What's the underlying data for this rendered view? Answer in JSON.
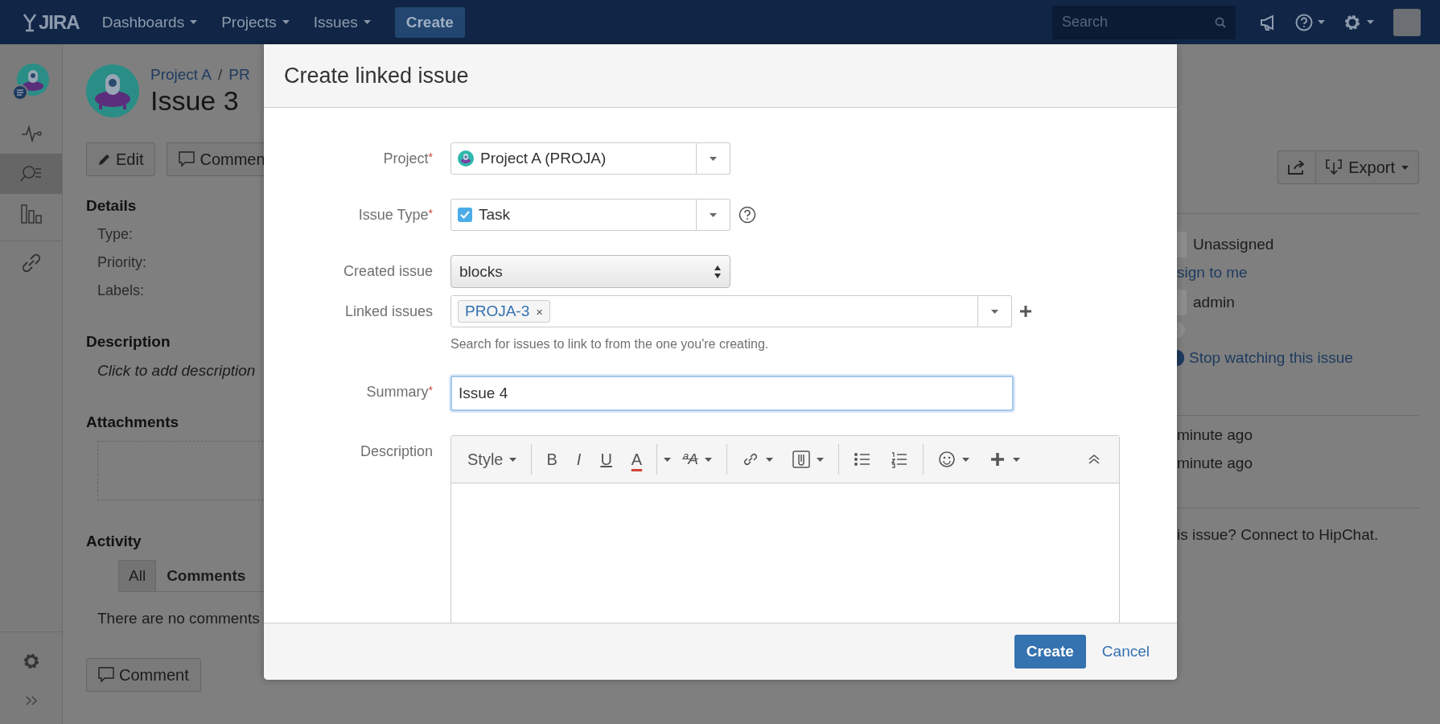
{
  "header": {
    "logo": "JIRA",
    "nav": [
      {
        "label": "Dashboards"
      },
      {
        "label": "Projects"
      },
      {
        "label": "Issues"
      }
    ],
    "create_button": "Create",
    "search": {
      "placeholder": "Search"
    }
  },
  "sidebar": {
    "items": [
      {
        "selected": false
      },
      {
        "selected": true
      },
      {
        "selected": false
      }
    ]
  },
  "issue": {
    "breadcrumb": [
      "Project A",
      "PR"
    ],
    "separator": "/",
    "title": "Issue 3",
    "actions": [
      "Edit",
      "Commen"
    ],
    "details": {
      "heading": "Details",
      "fields": [
        "Type:",
        "Priority:",
        "Labels:"
      ]
    },
    "description": {
      "heading": "Description",
      "placeholder": "Click to add description"
    },
    "attachments": {
      "heading": "Attachments"
    },
    "activity": {
      "heading": "Activity",
      "tabs": [
        {
          "label": "All",
          "selected": false
        },
        {
          "label": "Comments",
          "selected": true
        }
      ],
      "empty": "There are no comments",
      "comment_button": "Comment"
    }
  },
  "side": {
    "export_button": "Export",
    "assignee": "Unassigned",
    "assign_link": "sign to me",
    "reporter": "admin",
    "watch_link": "Stop watching this issue",
    "dates": [
      "minute ago",
      "minute ago"
    ],
    "hipchat": "is issue? Connect to HipChat."
  },
  "dialog": {
    "title": "Create linked issue",
    "fields": [
      {
        "kind": "project",
        "label": "Project",
        "required_mark": "*",
        "value": "Project A (PROJA)"
      },
      {
        "kind": "issue_type",
        "label": "Issue Type",
        "required_mark": "*",
        "value": "Task",
        "help": true
      },
      {
        "kind": "native_select",
        "label": "Created issue",
        "value": "blocks"
      },
      {
        "kind": "tags",
        "label": "Linked issues",
        "tags": [
          {
            "label": "PROJA-3",
            "remove": "×"
          }
        ],
        "hint": "Search for issues to link to from the one you're creating."
      },
      {
        "kind": "text",
        "label": "Summary",
        "required_mark": "*",
        "value": "Issue 4",
        "focused": true
      },
      {
        "kind": "editor",
        "label": "Description",
        "toolbar": {
          "style": "Style",
          "bold": "B",
          "italic": "I",
          "underline": "U",
          "font_color_label": "A",
          "effects": "ªA"
        }
      }
    ],
    "buttons": {
      "submit": "Create",
      "cancel": "Cancel"
    }
  }
}
